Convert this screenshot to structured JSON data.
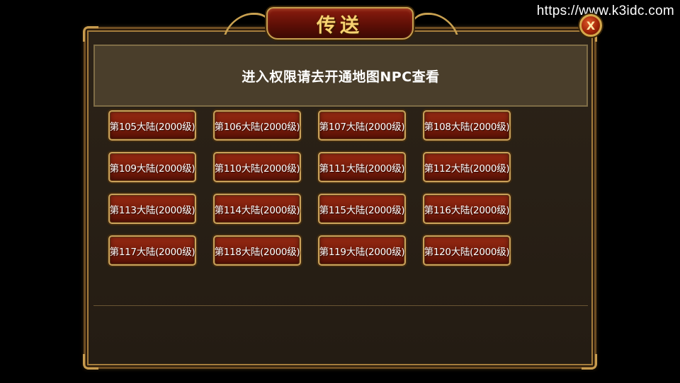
{
  "watermark": "https://www.k3idc.com",
  "window": {
    "title": "传送",
    "close_label": "X"
  },
  "notice": "进入权限请去开通地图NPC查看",
  "partial_row": [
    "",
    "",
    "",
    ""
  ],
  "lands": [
    "第105大陆(2000级)",
    "第106大陆(2000级)",
    "第107大陆(2000级)",
    "第108大陆(2000级)",
    "第109大陆(2000级)",
    "第110大陆(2000级)",
    "第111大陆(2000级)",
    "第112大陆(2000级)",
    "第113大陆(2000级)",
    "第114大陆(2000级)",
    "第115大陆(2000级)",
    "第116大陆(2000级)",
    "第117大陆(2000级)",
    "第118大陆(2000级)",
    "第119大陆(2000级)",
    "第120大陆(2000级)"
  ],
  "colors": {
    "button_red": "#7a1d0b",
    "gold_border": "#caa15a",
    "title_text": "#f7d372",
    "notice_bg": "#4a3e2b"
  }
}
